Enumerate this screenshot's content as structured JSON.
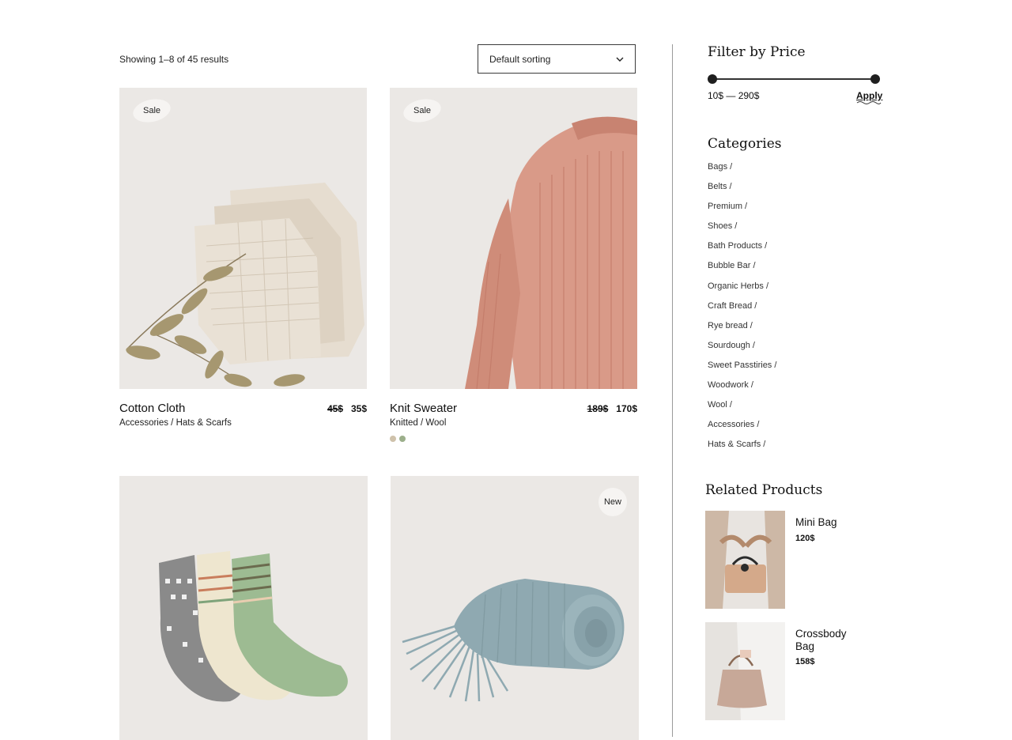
{
  "shop": {
    "results_text": "Showing 1–8 of 45 results",
    "sorting": {
      "selected": "Default sorting",
      "icon": "chevron-down-icon"
    }
  },
  "products": [
    {
      "name": "Cotton Cloth",
      "category": "Accessories / Hats & Scarfs",
      "badge": "Sale",
      "old_price": "45$",
      "price": "35$"
    },
    {
      "name": "Knit Sweater",
      "category": "Knitted / Wool",
      "badge": "Sale",
      "old_price": "189$",
      "price": "170$",
      "swatch_colors": [
        "#cfc2ab",
        "#9caf8b"
      ]
    },
    {
      "name": "",
      "category": "",
      "badge": ""
    },
    {
      "name": "",
      "category": "",
      "badge": "New"
    }
  ],
  "sidebar": {
    "price_filter": {
      "title": "Filter by Price",
      "range_text": "10$ — 290$",
      "apply_label": "Apply"
    },
    "categories": {
      "title": "Categories",
      "items": [
        "Bags /",
        "Belts /",
        "Premium /",
        "Shoes /",
        "Bath Products /",
        "Bubble Bar /",
        "Organic Herbs /",
        "Craft Bread /",
        "Rye bread /",
        "Sourdough /",
        "Sweet Passtiries /",
        "Woodwork /",
        "Wool /",
        "Accessories /",
        "Hats & Scarfs /"
      ]
    },
    "related": {
      "title": "Related Products",
      "items": [
        {
          "name": "Mini Bag",
          "price": "120$"
        },
        {
          "name": "Crossbody Bag",
          "price": "158$"
        }
      ]
    }
  },
  "colors": {
    "thumb_bg": "#ebe8e5",
    "accent": "#1f1f1f"
  }
}
